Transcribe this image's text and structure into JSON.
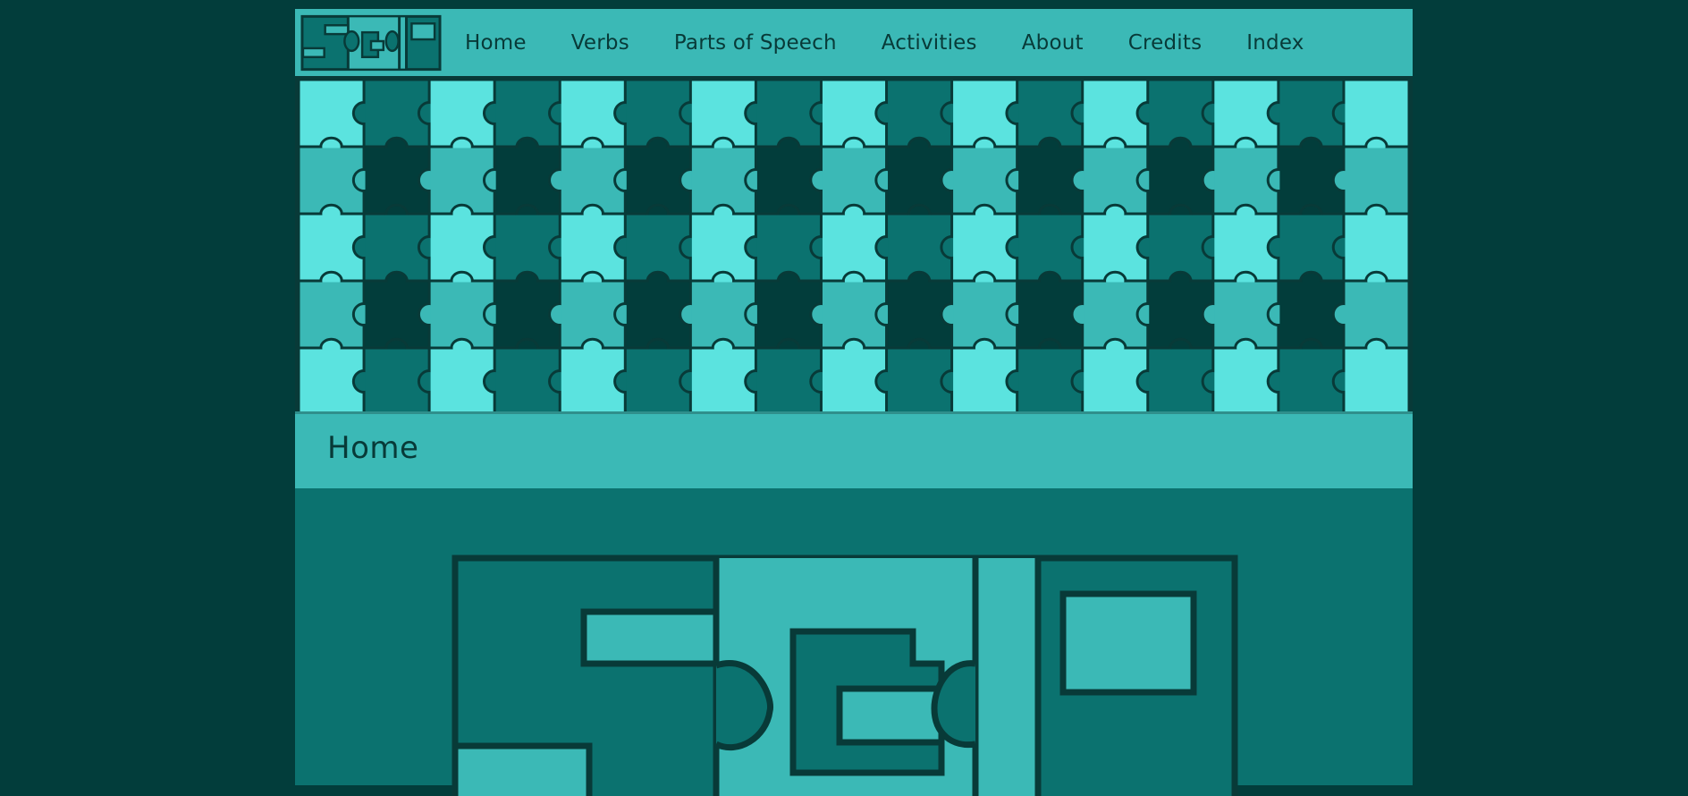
{
  "site": {
    "logo_text": "SGP"
  },
  "nav": {
    "items": [
      {
        "label": "Home"
      },
      {
        "label": "Verbs"
      },
      {
        "label": "Parts of Speech"
      },
      {
        "label": "Activities"
      },
      {
        "label": "About"
      },
      {
        "label": "Credits"
      },
      {
        "label": "Index"
      }
    ]
  },
  "main": {
    "title": "Home"
  },
  "colors": {
    "background": "#023d3b",
    "nav": "#3bb9b6",
    "content": "#0b726f",
    "piece_light": "#5be3df",
    "piece_mid": "#3bb9b6",
    "piece_teal": "#0b726f",
    "piece_dark": "#023d3b"
  },
  "icons": {
    "logo": "sgp-logo-icon",
    "banner": "puzzle-pieces-banner"
  }
}
